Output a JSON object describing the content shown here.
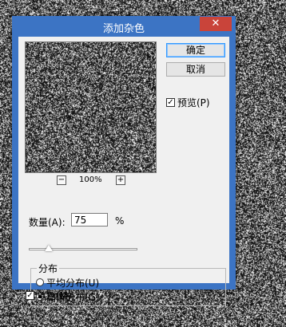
{
  "dialog": {
    "title": "添加杂色",
    "close_icon": "close-icon"
  },
  "buttons": {
    "ok_label": "确定",
    "cancel_label": "取消"
  },
  "preview": {
    "checkbox_label": "预览(P)",
    "checked": true,
    "zoom_value": "100%",
    "zoom_out_glyph": "−",
    "zoom_in_glyph": "+"
  },
  "amount": {
    "label": "数量(A):",
    "value": "75",
    "unit": "%",
    "slider_fraction": 0.18
  },
  "distribution": {
    "legend": "分布",
    "options": [
      {
        "label": "平均分布(U)",
        "selected": false
      },
      {
        "label": "高斯分布(G)",
        "selected": true
      }
    ]
  },
  "monochromatic": {
    "label": "单色(M)",
    "checked": true
  }
}
